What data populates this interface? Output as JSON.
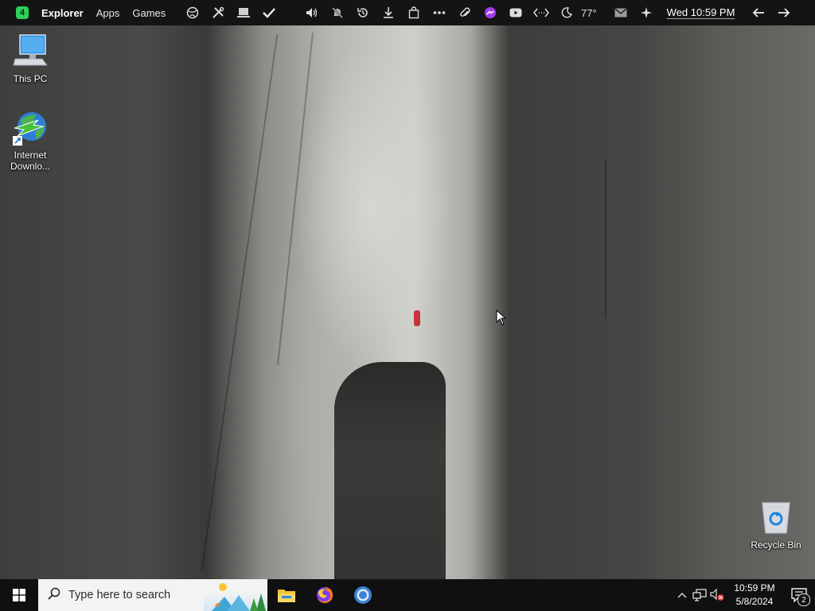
{
  "menubar": {
    "badge": "4",
    "menus": [
      "Explorer",
      "Apps",
      "Games"
    ],
    "temperature": "77°",
    "clock": "Wed 10:59 PM"
  },
  "desktop": {
    "icons": [
      {
        "label": "This PC",
        "icon": "computer-icon"
      },
      {
        "label": "Internet\nDownlo...",
        "icon": "idm-globe-icon"
      },
      {
        "label": "Recycle Bin",
        "icon": "recycle-bin-icon"
      }
    ]
  },
  "taskbar": {
    "search_placeholder": "Type here to search",
    "apps": [
      "file-explorer-icon",
      "firefox-icon",
      "chrome-icon"
    ],
    "time": "10:59 PM",
    "date": "5/8/2024",
    "notification_count": "2"
  },
  "colors": {
    "menubar_bg": "#141414",
    "taskbar_bg": "#101010",
    "badge_green": "#2fd05a",
    "messenger_purple": "#a33cf0"
  }
}
